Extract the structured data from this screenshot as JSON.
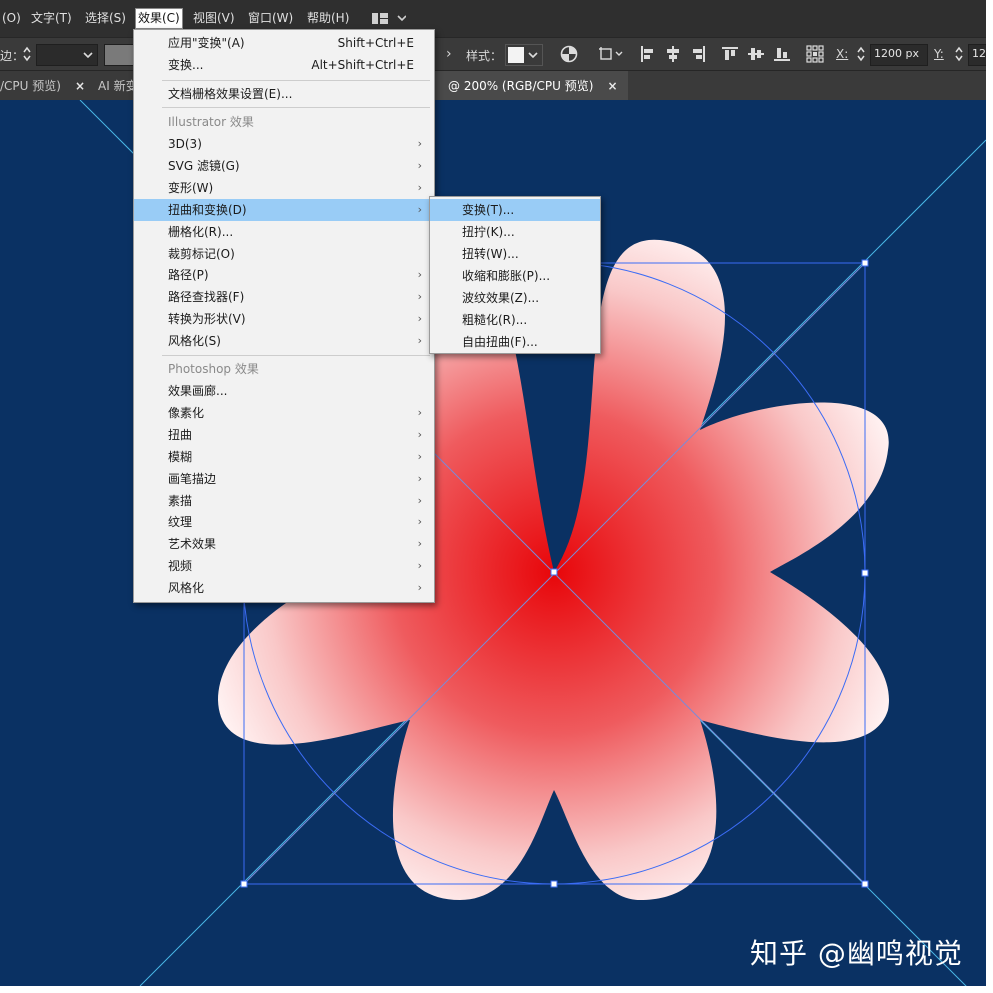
{
  "menubar": {
    "items": [
      {
        "label": "(O)"
      },
      {
        "label": "文字(T)"
      },
      {
        "label": "选择(S)"
      },
      {
        "label": "效果(C)"
      },
      {
        "label": "视图(V)"
      },
      {
        "label": "窗口(W)"
      },
      {
        "label": "帮助(H)"
      }
    ]
  },
  "toolbar": {
    "stroke_label": "边：",
    "style_label": "样式：",
    "x_label": "X:",
    "x_value": "1200 px",
    "y_label": "Y:",
    "y_value": "12"
  },
  "tabs": [
    {
      "label": "/CPU 预览)",
      "close": "×"
    },
    {
      "label": "AI 新变",
      "close": ""
    },
    {
      "label": "@ 200% (RGB/CPU 预览)",
      "close": "×"
    }
  ],
  "effect_menu": {
    "items": [
      {
        "label": "应用\"变换\"(A)",
        "shortcut": "Shift+Ctrl+E",
        "arrow": ""
      },
      {
        "label": "变换...",
        "shortcut": "Alt+Shift+Ctrl+E",
        "arrow": ""
      },
      {
        "label": "文档栅格效果设置(E)...",
        "shortcut": "",
        "arrow": ""
      },
      {
        "label": "Illustrator 效果",
        "shortcut": "",
        "arrow": ""
      },
      {
        "label": "3D(3)",
        "shortcut": "",
        "arrow": "›"
      },
      {
        "label": "SVG 滤镜(G)",
        "shortcut": "",
        "arrow": "›"
      },
      {
        "label": "变形(W)",
        "shortcut": "",
        "arrow": "›"
      },
      {
        "label": "扭曲和变换(D)",
        "shortcut": "",
        "arrow": "›"
      },
      {
        "label": "栅格化(R)...",
        "shortcut": "",
        "arrow": ""
      },
      {
        "label": "裁剪标记(O)",
        "shortcut": "",
        "arrow": ""
      },
      {
        "label": "路径(P)",
        "shortcut": "",
        "arrow": "›"
      },
      {
        "label": "路径查找器(F)",
        "shortcut": "",
        "arrow": "›"
      },
      {
        "label": "转换为形状(V)",
        "shortcut": "",
        "arrow": "›"
      },
      {
        "label": "风格化(S)",
        "shortcut": "",
        "arrow": "›"
      },
      {
        "label": "Photoshop 效果",
        "shortcut": "",
        "arrow": ""
      },
      {
        "label": "效果画廊...",
        "shortcut": "",
        "arrow": ""
      },
      {
        "label": "像素化",
        "shortcut": "",
        "arrow": "›"
      },
      {
        "label": "扭曲",
        "shortcut": "",
        "arrow": "›"
      },
      {
        "label": "模糊",
        "shortcut": "",
        "arrow": "›"
      },
      {
        "label": "画笔描边",
        "shortcut": "",
        "arrow": "›"
      },
      {
        "label": "素描",
        "shortcut": "",
        "arrow": "›"
      },
      {
        "label": "纹理",
        "shortcut": "",
        "arrow": "›"
      },
      {
        "label": "艺术效果",
        "shortcut": "",
        "arrow": "›"
      },
      {
        "label": "视频",
        "shortcut": "",
        "arrow": "›"
      },
      {
        "label": "风格化",
        "shortcut": "",
        "arrow": "›"
      }
    ]
  },
  "distort_submenu": {
    "items": [
      {
        "label": "变换(T)..."
      },
      {
        "label": "扭拧(K)..."
      },
      {
        "label": "扭转(W)..."
      },
      {
        "label": "收缩和膨胀(P)..."
      },
      {
        "label": "波纹效果(Z)..."
      },
      {
        "label": "粗糙化(R)..."
      },
      {
        "label": "自由扭曲(F)..."
      }
    ]
  },
  "watermark": "知乎 @幽鸣视觉",
  "colors": {
    "canvas_bg": "#0a3163",
    "flower_center": "#e8060a",
    "flower_edge": "#fff1f1",
    "selection": "#3b6cf5",
    "guide": "#49b8e6",
    "menu_highlight": "#99ccf6"
  }
}
